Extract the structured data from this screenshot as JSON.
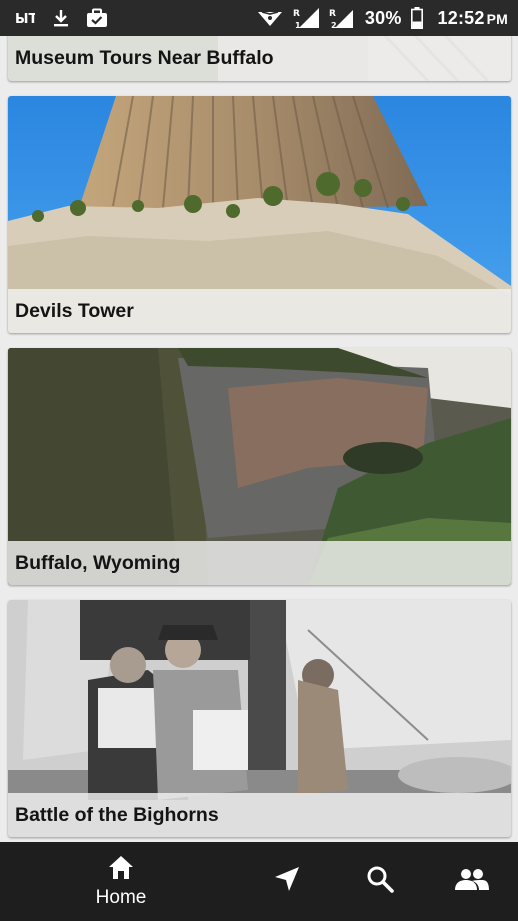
{
  "status_bar": {
    "left_icons": [
      "carrier-icon",
      "download-icon",
      "briefcase-icon"
    ],
    "right_icons": [
      "vpn-key-icon",
      "signal-sim1-icon",
      "signal-sim2-icon",
      "battery-icon"
    ],
    "battery_percent": "30%",
    "time": "12:52",
    "ampm": "PM"
  },
  "feed": {
    "cards": [
      {
        "label": "Museum Tours Near Buffalo"
      },
      {
        "label": "Devils Tower"
      },
      {
        "label": "Buffalo, Wyoming"
      },
      {
        "label": "Battle of the Bighorns"
      }
    ]
  },
  "bottom_nav": {
    "active": "home",
    "items": [
      {
        "id": "home",
        "label": "Home",
        "icon": "home-icon"
      },
      {
        "id": "directions",
        "label": "",
        "icon": "navigation-arrow-icon"
      },
      {
        "id": "search",
        "label": "",
        "icon": "search-icon"
      },
      {
        "id": "people",
        "label": "",
        "icon": "people-icon"
      }
    ]
  },
  "colors": {
    "status_bar_bg": "#2a2a2a",
    "page_bg": "#ececec",
    "label_strip": "#f0f0f0",
    "bottom_nav_bg": "#1e1e1e",
    "sky_blue": "#2f8fe6"
  }
}
